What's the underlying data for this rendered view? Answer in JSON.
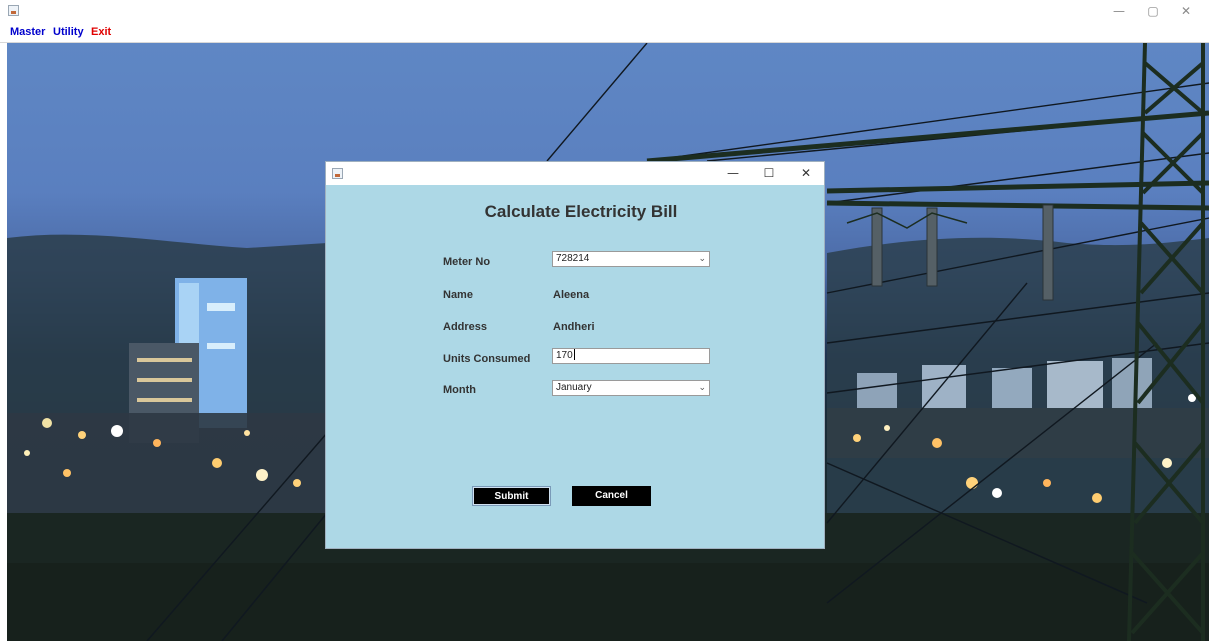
{
  "window": {
    "controls": {
      "minimize": "—",
      "maximize": "▢",
      "close": "✕"
    }
  },
  "menubar": {
    "items": [
      {
        "label": "Master",
        "color": "#0000cc"
      },
      {
        "label": "Utility",
        "color": "#0000cc"
      },
      {
        "label": "Exit",
        "color": "#e00000"
      }
    ]
  },
  "dialog": {
    "controls": {
      "minimize": "—",
      "maximize": "☐",
      "close": "✕"
    },
    "heading": "Calculate Electricity Bill",
    "background": "#add8e6",
    "fields": {
      "meter_no": {
        "label": "Meter No",
        "value": "728214"
      },
      "name": {
        "label": "Name",
        "value": "Aleena"
      },
      "address": {
        "label": "Address",
        "value": "Andheri"
      },
      "units_consumed": {
        "label": "Units Consumed",
        "value": "170"
      },
      "month": {
        "label": "Month",
        "value": "January"
      }
    },
    "buttons": {
      "submit": "Submit",
      "cancel": "Cancel"
    }
  },
  "icons": {
    "app": "java-cup-icon",
    "dropdown": "chevron-down-icon"
  }
}
